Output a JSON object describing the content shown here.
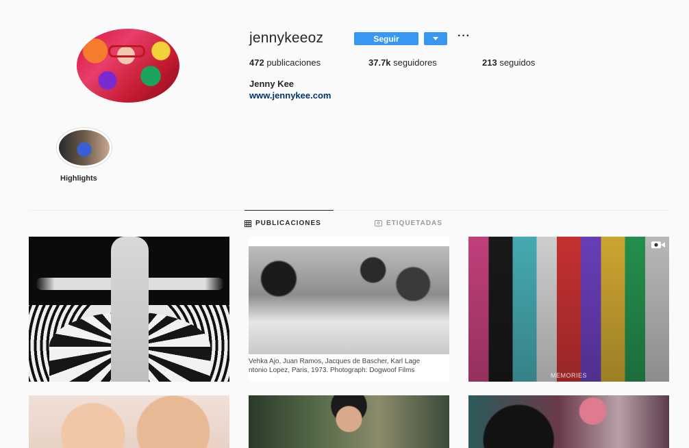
{
  "profile": {
    "username": "jennykeeoz",
    "follow_label": "Seguir",
    "more_label": "···",
    "full_name": "Jenny Kee",
    "website": "www.jennykee.com",
    "stats": {
      "posts_value": "472",
      "posts_label": "publicaciones",
      "followers_value": "37.7k",
      "followers_label": "seguidores",
      "following_value": "213",
      "following_label": "seguidos"
    }
  },
  "highlights": [
    {
      "label": "Highlights"
    }
  ],
  "tabs": [
    {
      "label": "PUBLICACIONES",
      "icon": "grid-icon",
      "active": true
    },
    {
      "label": "ETIQUETADAS",
      "icon": "tagged-icon",
      "active": false
    }
  ],
  "posts": {
    "p2_caption_line1": "Vehka Ajo, Juan Ramos, Jacques de Bascher, Karl Lage",
    "p2_caption_line2": "ntonio Lopez, Paris, 1973. Photograph: Dogwoof Films",
    "p3_overlay": "MEMORIES"
  },
  "colors": {
    "accent": "#3897f0",
    "link": "#003569",
    "text": "#262626",
    "muted": "#999999",
    "background": "#fafafa"
  }
}
